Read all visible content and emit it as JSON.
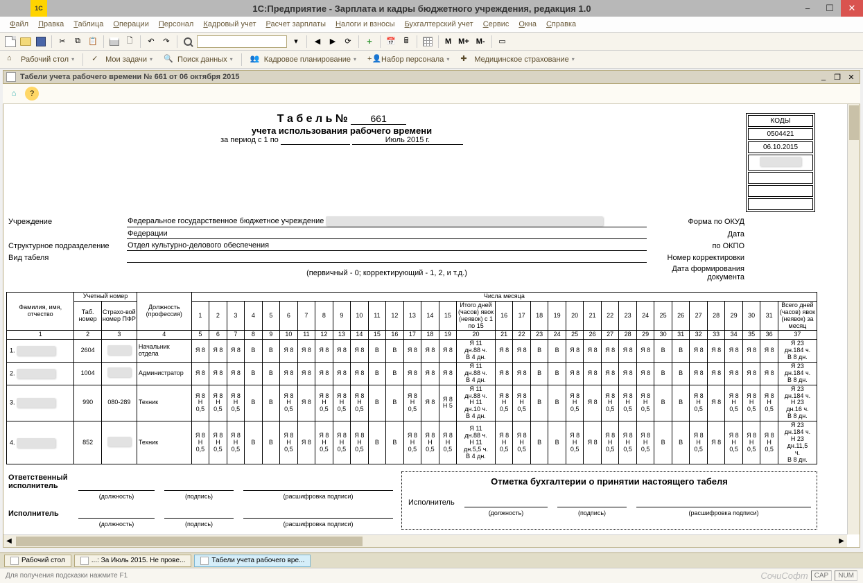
{
  "window": {
    "title": "1С:Предприятие - Зарплата и кадры бюджетного учреждения, редакция 1.0"
  },
  "menu": {
    "items": [
      "Файл",
      "Правка",
      "Таблица",
      "Операции",
      "Персонал",
      "Кадровый учет",
      "Расчет зарплаты",
      "Налоги и взносы",
      "Бухгалтерский учет",
      "Сервис",
      "Окна",
      "Справка"
    ]
  },
  "toolbar1": {
    "m_plain": "M",
    "m_plus": "M+",
    "m_minus": "M-"
  },
  "appbar": {
    "items": [
      "Рабочий стол",
      "Мои задачи",
      "Поиск данных",
      "Кадровое планирование",
      "Набор персонала",
      "Медицинское страхование"
    ]
  },
  "doc": {
    "tab_title": "Табели учета рабочего времени № 661 от 06 октября 2015"
  },
  "report": {
    "title_prefix": "Т а б е л ь №",
    "title_num": "661",
    "subtitle": "учета использования рабочего времени",
    "period_lbl": "за период с 1 по",
    "period_val": "Июль 2015 г.",
    "institution_lbl": "Учреждение",
    "institution_val": "Федеральное государственное бюджетное учреждение",
    "institution_val2": "Федерации",
    "subdiv_lbl": "Структурное подразделение",
    "subdiv_val": "Отдел культурно-делового обеспечения",
    "type_lbl": "Вид табеля",
    "type_note": "(первичный - 0; корректирующий - 1, 2, и т.д.)",
    "okud_lbl": "Форма по ОКУД",
    "date_lbl": "Дата",
    "okpo_lbl": "по ОКПО",
    "corr_lbl": "Номер корректировки",
    "formdate_lbl": "Дата формирования документа",
    "codes_hdr": "КОДЫ",
    "okud": "0504421",
    "date": "06.10.2015",
    "okpo": "",
    "corr": "",
    "formdate": ""
  },
  "table": {
    "head": {
      "col_fio": "Фамилия, имя, отчество",
      "col_uch": "Учетный номер",
      "col_tab": "Таб. номер",
      "col_pfr": "Страхо-вой номер ПФР",
      "col_pos": "Должность (профессия)",
      "col_days": "Числа месяца",
      "col_half": "Итого дней (часов) явок (неявок) с 1 по 15",
      "col_total": "Всего дней (часов) явок (неявок) за месяц"
    },
    "nums": [
      "1",
      "2",
      "3",
      "4",
      "5",
      "6",
      "7",
      "8",
      "9",
      "10",
      "11",
      "12",
      "13",
      "14",
      "15",
      "16",
      "17",
      "18",
      "19",
      "20",
      "21",
      "22",
      "23",
      "24",
      "25",
      "26",
      "27",
      "28",
      "29",
      "30",
      "31",
      "32",
      "33",
      "34",
      "35",
      "36",
      "37"
    ],
    "days1": [
      "1",
      "2",
      "3",
      "4",
      "5",
      "6",
      "7",
      "8",
      "9",
      "10",
      "11",
      "12",
      "13",
      "14",
      "15"
    ],
    "days2": [
      "16",
      "17",
      "18",
      "19",
      "20",
      "21",
      "22",
      "23",
      "24",
      "25",
      "26",
      "27",
      "28",
      "29",
      "30",
      "31"
    ],
    "rows": [
      {
        "n": "1",
        "tab": "2604",
        "pfr": "",
        "pos": "Начальник отдела",
        "d1": [
          "Я 8",
          "Я 8",
          "Я 8",
          "В",
          "В",
          "Я 8",
          "Я 8",
          "Я 8",
          "Я 8",
          "Я 8",
          "В",
          "В",
          "Я 8",
          "Я 8",
          "Я 8"
        ],
        "half": "Я 11\nдн.88 ч.\nВ 4 дн.",
        "d2": [
          "Я 8",
          "Я 8",
          "В",
          "В",
          "Я 8",
          "Я 8",
          "Я 8",
          "Я 8",
          "Я 8",
          "В",
          "В",
          "Я 8",
          "Я 8",
          "Я 8",
          "Я 8",
          "Я 8"
        ],
        "tot": "Я 23\nдн.184 ч.\nВ 8 дн."
      },
      {
        "n": "2",
        "tab": "1004",
        "pfr": "",
        "pos": "Администратор",
        "d1": [
          "Я 8",
          "Я 8",
          "Я 8",
          "В",
          "В",
          "Я 8",
          "Я 8",
          "Я 8",
          "Я 8",
          "Я 8",
          "В",
          "В",
          "Я 8",
          "Я 8",
          "Я 8"
        ],
        "half": "Я 11\nдн.88 ч.\nВ 4 дн.",
        "d2": [
          "Я 8",
          "Я 8",
          "В",
          "В",
          "Я 8",
          "Я 8",
          "Я 8",
          "Я 8",
          "Я 8",
          "В",
          "В",
          "Я 8",
          "Я 8",
          "Я 8",
          "Я 8",
          "Я 8"
        ],
        "tot": "Я 23\nдн.184 ч.\nВ 8 дн."
      },
      {
        "n": "3",
        "tab": "990",
        "pfr": "080-289",
        "pos": "Техник",
        "d1": [
          "Я 8\nН\n0,5",
          "Я 8\nН\n0,5",
          "Я 8\nН\n0,5",
          "В",
          "В",
          "Я 8\nН\n0,5",
          "Я 8",
          "Я 8\nН\n0,5",
          "Я 8\nН\n0,5",
          "Я 8\nН\n0,5",
          "В",
          "В",
          "Я 8\nН\n0,5",
          "Я 8",
          "Я 8\nН 5"
        ],
        "half": "Я 11\nдн.88 ч.\nН 11\nдн.10 ч.\nВ 4 дн.",
        "d2": [
          "Я 8\nН\n0,5",
          "Я 8\nН\n0,5",
          "В",
          "В",
          "Я 8\nН\n0,5",
          "Я 8",
          "Я 8\nН\n0,5",
          "Я 8\nН\n0,5",
          "Я 8\nН\n0,5",
          "В",
          "В",
          "Я 8\nН\n0,5",
          "Я 8",
          "Я 8\nН\n0,5",
          "Я 8\nН\n0,5",
          "Я 8\nН\n0,5"
        ],
        "tot": "Я 23\nдн.184 ч.\nН 23\nдн.16 ч.\nВ 8 дн."
      },
      {
        "n": "4",
        "tab": "852",
        "pfr": "",
        "pos": "Техник",
        "d1": [
          "Я 8\nН\n0,5",
          "Я 8\nН\n0,5",
          "Я 8\nН\n0,5",
          "В",
          "В",
          "Я 8\nН\n0,5",
          "Я 8",
          "Я 8\nН\n0,5",
          "Я 8\nН\n0,5",
          "Я 8\nН\n0,5",
          "В",
          "В",
          "Я 8\nН\n0,5",
          "Я 8\nН\n0,5",
          "Я 8\nН\n0,5"
        ],
        "half": "Я 11\nдн.88 ч.\nН 11\nдн.5,5 ч.\nВ 4 дн.",
        "d2": [
          "Я 8\nН\n0,5",
          "Я 8\nН\n0,5",
          "В",
          "В",
          "Я 8\nН\n0,5",
          "Я 8",
          "Я 8\nН\n0,5",
          "Я 8\nН\n0,5",
          "Я 8\nН\n0,5",
          "В",
          "В",
          "Я 8\nН\n0,5",
          "Я 8",
          "Я 8\nН\n0,5",
          "Я 8\nН\n0,5",
          "Я 8\nН\n0,5"
        ],
        "tot": "Я 23\nдн.184 ч.\nН 23\nдн.11,5\nч.\nВ 8 дн."
      }
    ]
  },
  "footer": {
    "resp": "Ответственный исполнитель",
    "exec": "Исполнитель",
    "pos": "(должность)",
    "sig": "(подпись)",
    "name": "(расшифровка подписи)",
    "acc_title": "Отметка бухгалтерии о принятии настоящего табеля",
    "acc_exec": "Исполнитель"
  },
  "status": {
    "tab1": "Рабочий стол",
    "tab2": "...: За Июль 2015. Не прове...",
    "tab3": "Табели учета рабочего вре...",
    "hint": "Для получения подсказки нажмите F1",
    "brand": "СочиСофт",
    "cap": "CAP",
    "num": "NUM"
  }
}
